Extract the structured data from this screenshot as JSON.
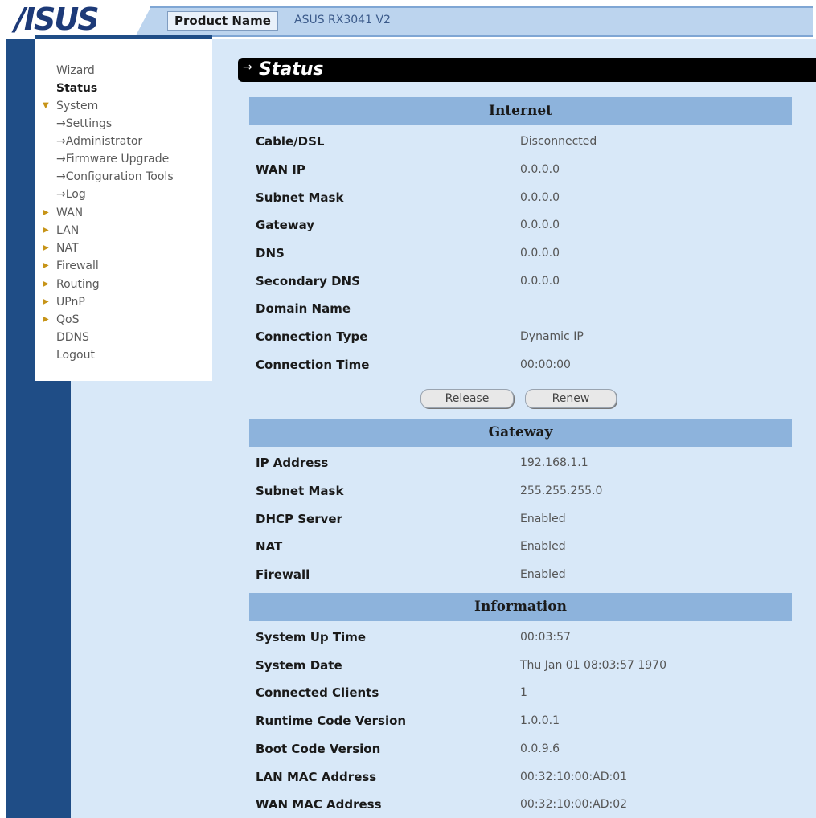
{
  "brand": {
    "logo": "/ISUS"
  },
  "header": {
    "product_label": "Product Name",
    "product_value": "ASUS RX3041 V2"
  },
  "sidebar": {
    "items": [
      {
        "label": "Wizard"
      },
      {
        "label": "Status"
      },
      {
        "label": "System"
      },
      {
        "label": "→Settings"
      },
      {
        "label": "→Administrator"
      },
      {
        "label": "→Firmware Upgrade"
      },
      {
        "label": "→Configuration Tools"
      },
      {
        "label": "→Log"
      },
      {
        "label": "WAN"
      },
      {
        "label": "LAN"
      },
      {
        "label": "NAT"
      },
      {
        "label": "Firewall"
      },
      {
        "label": "Routing"
      },
      {
        "label": "UPnP"
      },
      {
        "label": "QoS"
      },
      {
        "label": "DDNS"
      },
      {
        "label": "Logout"
      }
    ]
  },
  "page": {
    "title": "Status"
  },
  "internet": {
    "heading": "Internet",
    "rows": [
      {
        "label": "Cable/DSL",
        "value": "Disconnected"
      },
      {
        "label": "WAN IP",
        "value": "0.0.0.0"
      },
      {
        "label": "Subnet Mask",
        "value": "0.0.0.0"
      },
      {
        "label": "Gateway",
        "value": "0.0.0.0"
      },
      {
        "label": "DNS",
        "value": "0.0.0.0"
      },
      {
        "label": "Secondary DNS",
        "value": "0.0.0.0"
      },
      {
        "label": "Domain Name",
        "value": ""
      },
      {
        "label": "Connection Type",
        "value": "Dynamic IP"
      },
      {
        "label": "Connection Time",
        "value": "00:00:00"
      }
    ],
    "release_label": "Release",
    "renew_label": "Renew"
  },
  "gateway": {
    "heading": "Gateway",
    "rows": [
      {
        "label": "IP Address",
        "value": "192.168.1.1"
      },
      {
        "label": "Subnet Mask",
        "value": "255.255.255.0"
      },
      {
        "label": "DHCP Server",
        "value": "Enabled"
      },
      {
        "label": "NAT",
        "value": "Enabled"
      },
      {
        "label": "Firewall",
        "value": "Enabled"
      }
    ]
  },
  "information": {
    "heading": "Information",
    "rows": [
      {
        "label": "System Up Time",
        "value": "00:03:57"
      },
      {
        "label": "System Date",
        "value": "Thu Jan 01 08:03:57 1970"
      },
      {
        "label": "Connected Clients",
        "value": "1"
      },
      {
        "label": "Runtime Code Version",
        "value": "1.0.0.1"
      },
      {
        "label": "Boot Code Version",
        "value": "0.0.9.6"
      },
      {
        "label": "LAN MAC Address",
        "value": "00:32:10:00:AD:01"
      },
      {
        "label": "WAN MAC Address",
        "value": "00:32:10:00:AD:02"
      }
    ]
  }
}
